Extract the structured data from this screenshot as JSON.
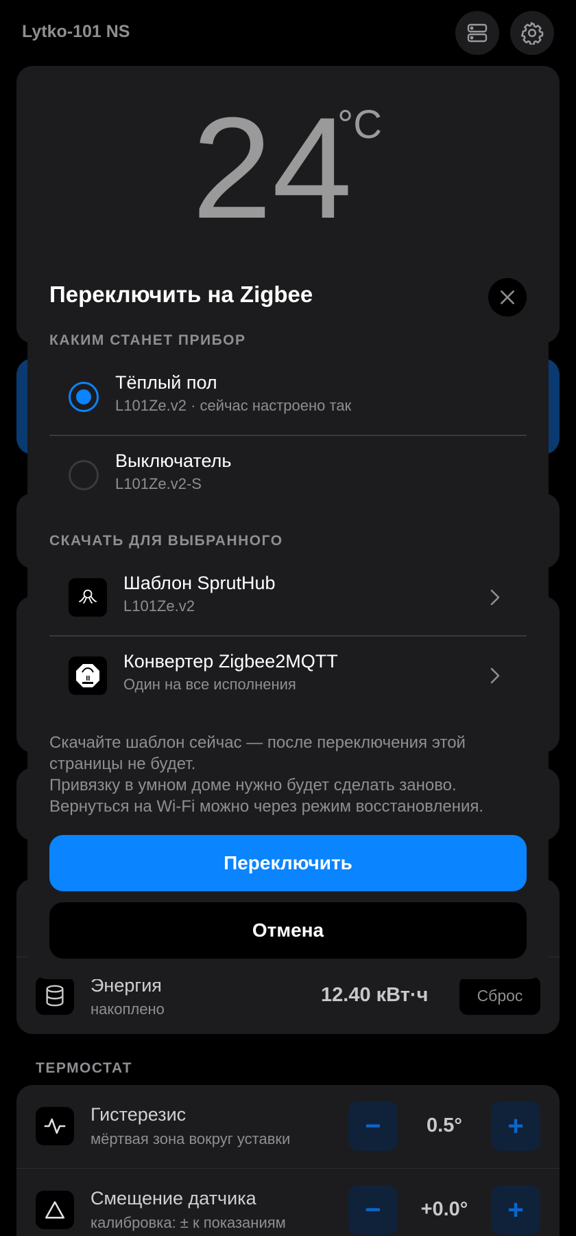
{
  "app": {
    "title": "Lytko-101 NS"
  },
  "header": {
    "server_icon": "server-icon",
    "settings_icon": "gear-icon"
  },
  "temperature": {
    "value": "24",
    "unit": "°C"
  },
  "energy": {
    "title": "Энергия",
    "subtitle": "накоплено",
    "value": "12.40 кВт·ч",
    "reset_label": "Сброс"
  },
  "thermostat": {
    "section_label": "ТЕРМОСТАТ",
    "rows": [
      {
        "title": "Гистерезис",
        "subtitle": "мёртвая зона вокруг уставки",
        "value": "0.5°",
        "minus": "−",
        "plus": "+"
      },
      {
        "title": "Смещение датчика",
        "subtitle": "калибровка: ± к показаниям",
        "value": "+0.0°",
        "minus": "−",
        "plus": "+"
      }
    ]
  },
  "modal": {
    "title": "Переключить на Zigbee",
    "section_device": "КАКИМ СТАНЕТ ПРИБОР",
    "options": [
      {
        "title": "Тёплый пол",
        "subtitle": "L101Ze.v2 · сейчас настроено так",
        "selected": true
      },
      {
        "title": "Выключатель",
        "subtitle": "L101Ze.v2-S",
        "selected": false
      }
    ],
    "section_download": "СКАЧАТЬ ДЛЯ ВЫБРАННОГО",
    "downloads": [
      {
        "title": "Шаблон SprutHub",
        "subtitle": "L101Ze.v2",
        "icon": "spruthub-logo-icon"
      },
      {
        "title": "Конвертер Zigbee2MQTT",
        "subtitle": "Один на все исполнения",
        "icon": "zigbee2mqtt-logo-icon"
      }
    ],
    "note_lines": [
      "Скачайте шаблон сейчас — после переключения этой страницы не будет.",
      "Привязку в умном доме нужно будет сделать заново.",
      "Вернуться на Wi-Fi можно через режим восстановления."
    ],
    "confirm_label": "Переключить",
    "cancel_label": "Отмена"
  },
  "colors": {
    "accent": "#0a84ff",
    "surface": "#1c1c1e",
    "background": "#000000",
    "muted_text": "#8e8e93"
  }
}
